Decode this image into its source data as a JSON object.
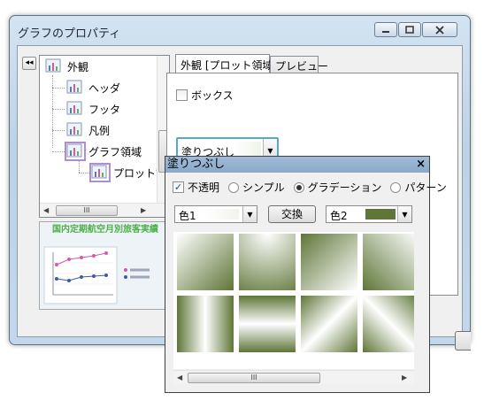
{
  "window": {
    "title": "グラフのプロパティ",
    "buttons": [
      "minimize",
      "maximize",
      "close"
    ]
  },
  "left_panel": {
    "collapse_button": "◂◂",
    "tree_items": [
      {
        "label": "外観",
        "icon": "graph-node-icon"
      },
      {
        "label": "ヘッダ",
        "icon": "graph-node-icon"
      },
      {
        "label": "フッタ",
        "icon": "graph-node-icon"
      },
      {
        "label": "凡例",
        "icon": "graph-node-icon"
      },
      {
        "label": "グラフ領域",
        "icon": "graph-node-icon"
      },
      {
        "label": "プロットʿ",
        "icon": "graph-node-icon"
      }
    ],
    "hscroll_thumb": "III",
    "preview_title": "国内定期航空月別旅客実績"
  },
  "tabs": [
    {
      "label": "外観 [プロット領域]",
      "active": true
    },
    {
      "label": "プレビュー",
      "active": false
    }
  ],
  "appearance": {
    "box_label": "ボックス",
    "box_checked": false,
    "fill_label": "塗りつぶし"
  },
  "fill_popup": {
    "title": "塗りつぶし",
    "close": "×",
    "opacity_label": "不透明",
    "opacity_checked": true,
    "modes": [
      "シンプル",
      "グラデーション",
      "パターン"
    ],
    "selected_mode": "グラデーション",
    "color1_label": "色1",
    "color1": "#ffffff",
    "swap_label": "交換",
    "color2_label": "色2",
    "color2": "#5e7638",
    "hscroll_thumb": "III"
  },
  "colors": {
    "accent": "#5aa5d8",
    "gradient_dark": "#5e7638",
    "gradient_light": "#ffffff",
    "preview_title": "#4cb04a"
  }
}
